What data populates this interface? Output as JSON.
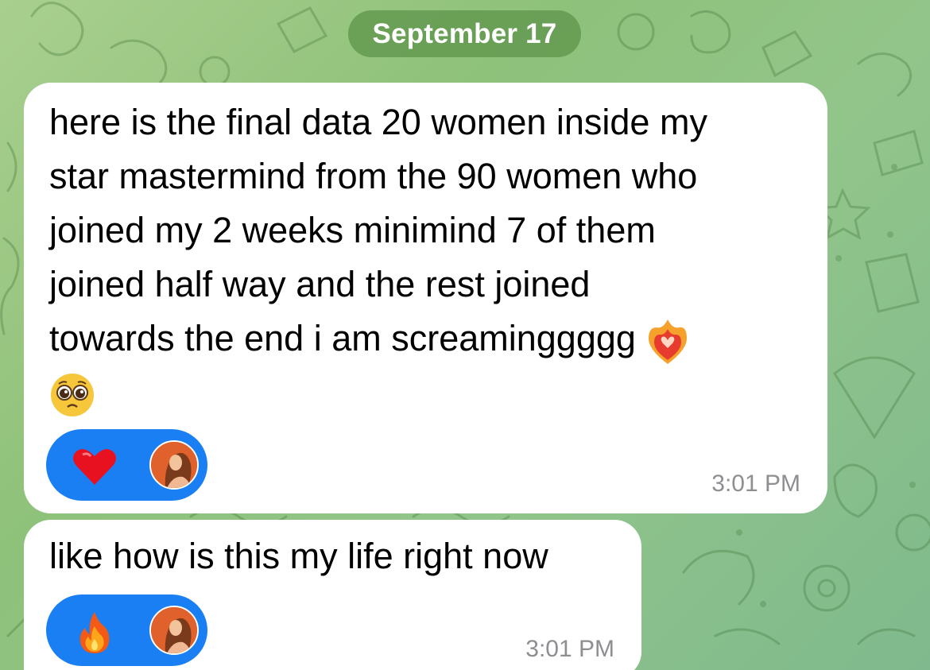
{
  "chat": {
    "date_label": "September 17",
    "messages": [
      {
        "text_lines": [
          "here is the final data 20 women inside my",
          "star mastermind from the 90 women who",
          "joined my 2 weeks minimind 7 of them",
          "joined half way and the rest joined",
          "towards the end i am screaminggggg"
        ],
        "inline_emojis": [
          "heart-on-fire-emoji",
          "pleading-face-emoji"
        ],
        "reaction": {
          "emoji": "red-heart-emoji",
          "reactor": "user-avatar"
        },
        "time": "3:01 PM"
      },
      {
        "text_lines": [
          "like how is this my life right now"
        ],
        "reaction": {
          "emoji": "fire-emoji",
          "reactor": "user-avatar"
        },
        "time": "3:01 PM"
      }
    ]
  },
  "colors": {
    "background": "#8ec17a",
    "date_pill": "#5f964b",
    "bubble": "#ffffff",
    "reaction_pill": "#1a7ff3",
    "timestamp": "#8e8e93"
  }
}
